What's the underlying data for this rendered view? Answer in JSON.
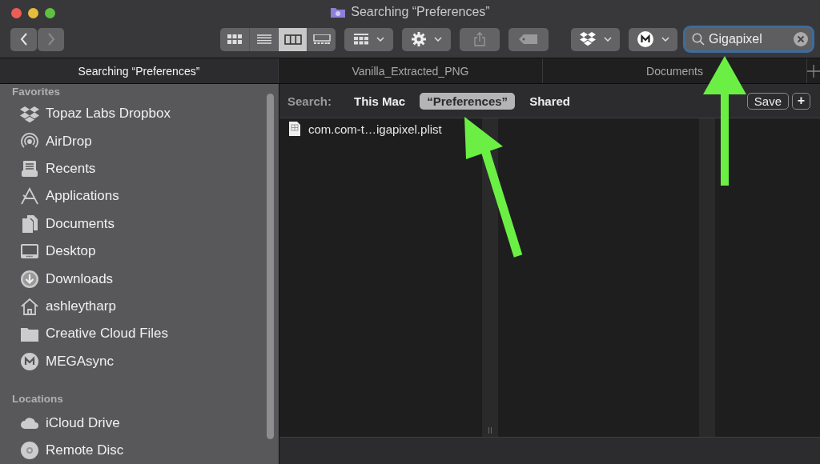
{
  "window": {
    "title": "Searching “Preferences”"
  },
  "toolbar": {
    "view_modes": [
      {
        "kind": "icons",
        "selected": false
      },
      {
        "kind": "list",
        "selected": false
      },
      {
        "kind": "columns",
        "selected": true
      },
      {
        "kind": "gallery",
        "selected": false
      }
    ],
    "search": {
      "value": "Gigapixel"
    }
  },
  "tabs": [
    {
      "label": "Searching “Preferences”",
      "selected": true
    },
    {
      "label": "Vanilla_Extracted_PNG",
      "selected": false
    },
    {
      "label": "Documents",
      "selected": false
    }
  ],
  "sidebar": {
    "sections": [
      {
        "title": "Favorites",
        "items": [
          {
            "label": "Topaz Labs Dropbox",
            "kind": "dropbox"
          },
          {
            "label": "AirDrop",
            "kind": "airdrop"
          },
          {
            "label": "Recents",
            "kind": "recents"
          },
          {
            "label": "Applications",
            "kind": "apps"
          },
          {
            "label": "Documents",
            "kind": "docs"
          },
          {
            "label": "Desktop",
            "kind": "desktop"
          },
          {
            "label": "Downloads",
            "kind": "downloads"
          },
          {
            "label": "ashleytharp",
            "kind": "home"
          },
          {
            "label": "Creative Cloud Files",
            "kind": "folder"
          },
          {
            "label": "MEGAsync",
            "kind": "mega"
          }
        ]
      },
      {
        "title": "Locations",
        "items": [
          {
            "label": "iCloud Drive",
            "kind": "cloud"
          },
          {
            "label": "Remote Disc",
            "kind": "disc"
          }
        ]
      }
    ]
  },
  "search_bar": {
    "label": "Search:",
    "scopes": [
      {
        "label": "This Mac",
        "selected": false
      },
      {
        "label": "“Preferences”",
        "selected": true
      },
      {
        "label": "Shared",
        "selected": false
      }
    ],
    "save": "Save",
    "add": "+"
  },
  "results": [
    {
      "name": "com.com-t…igapixel.plist"
    }
  ]
}
